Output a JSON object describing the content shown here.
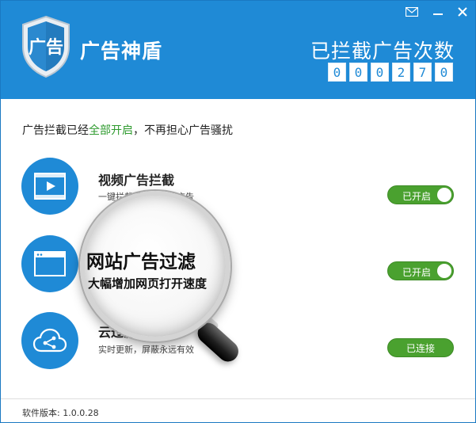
{
  "app": {
    "title": "广告神盾"
  },
  "window_controls": {
    "feedback_icon": "envelope-icon",
    "minimize_icon": "minimize-icon",
    "close_icon": "close-icon"
  },
  "counter": {
    "label": "已拦截广告次数",
    "digits": [
      "0",
      "0",
      "0",
      "2",
      "7",
      "0"
    ]
  },
  "status": {
    "prefix": "广告拦截已经",
    "highlight": "全部开启",
    "suffix": "，不再担心广告骚扰",
    "highlight_color": "#2f9b2f"
  },
  "features": [
    {
      "icon": "video-icon",
      "title": "视频广告拦截",
      "desc": "一键拦截看视频时的广告",
      "button": "已开启"
    },
    {
      "icon": "browser-window-icon",
      "title": "网站广告过滤",
      "desc": "大幅增加网页打开速度",
      "button": "已开启"
    },
    {
      "icon": "cloud-share-icon",
      "title": "云过滤库",
      "desc": "实时更新，屏蔽永远有效",
      "button": "已连接"
    }
  ],
  "footer": {
    "version": "软件版本: 1.0.0.28"
  },
  "colors": {
    "header": "#1f8ad6",
    "toggle_on": "#4aa12f"
  }
}
